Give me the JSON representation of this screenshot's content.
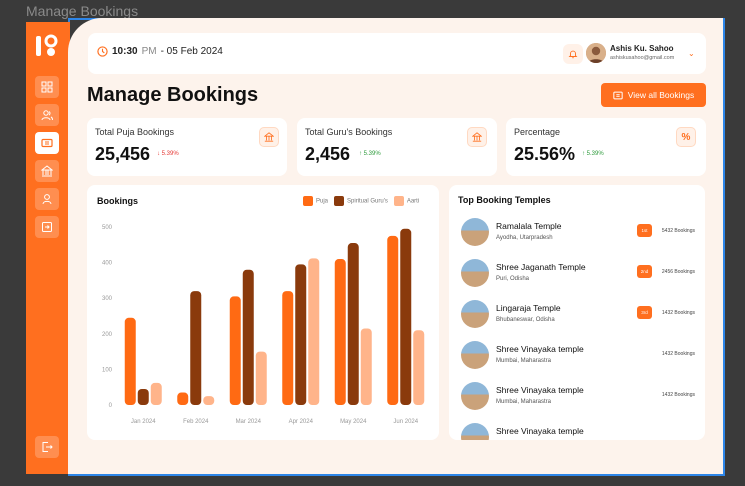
{
  "window": {
    "title": "Manage Bookings"
  },
  "header": {
    "time": "10:30",
    "ampm": "PM",
    "date": "- 05 Feb 2024",
    "user_name": "Ashis Ku. Sahoo",
    "user_email": "ashiskusahoo@gmail.com"
  },
  "page": {
    "title": "Manage Bookings",
    "view_all_label": "View all Bookings"
  },
  "stats": [
    {
      "label": "Total Puja Bookings",
      "value": "25,456",
      "change": "5.39%",
      "trend": "down",
      "color": "#e53935"
    },
    {
      "label": "Total  Guru's Bookings",
      "value": "2,456",
      "change": "5.39%",
      "trend": "up",
      "color": "#2e9b3c"
    },
    {
      "label": "Percentage",
      "value": "25.56%",
      "change": "5.39%",
      "trend": "up",
      "color": "#2e9b3c"
    }
  ],
  "chart_data": {
    "type": "bar",
    "title": "Bookings",
    "categories": [
      "Jan 2024",
      "Feb 2024",
      "Mar 2024",
      "Apr 2024",
      "May 2024",
      "Jun 2024"
    ],
    "series": [
      {
        "name": "Puja",
        "color": "#ff6a13",
        "values": [
          245,
          35,
          305,
          320,
          410,
          475
        ]
      },
      {
        "name": "Spiritual Guru's",
        "color": "#8a3a0c",
        "values": [
          45,
          320,
          380,
          395,
          455,
          495
        ]
      },
      {
        "name": "Aarti",
        "color": "#ffb48a",
        "values": [
          62,
          25,
          150,
          412,
          215,
          210
        ]
      }
    ],
    "yticks": [
      0,
      100,
      200,
      300,
      400,
      500
    ],
    "ylim": [
      0,
      500
    ],
    "legend": "top-right",
    "grid": false
  },
  "temples": {
    "title": "Top Booking Temples",
    "items": [
      {
        "name": "Ramalala Temple",
        "location": "Ayodha, Utarpradesh",
        "rank": "1st",
        "bookings": "5432 Bookings"
      },
      {
        "name": "Shree Jaganath Temple",
        "location": "Puri, Odisha",
        "rank": "2nd",
        "bookings": "2456 Bookings"
      },
      {
        "name": "Lingaraja Temple",
        "location": "Bhubaneswar, Odisha",
        "rank": "3rd",
        "bookings": "1432 Bookings"
      },
      {
        "name": "Shree Vinayaka temple",
        "location": "Mumbai, Maharastra",
        "rank": "",
        "bookings": "1432 Bookings"
      },
      {
        "name": "Shree Vinayaka temple",
        "location": "Mumbai, Maharastra",
        "rank": "",
        "bookings": "1432 Bookings"
      },
      {
        "name": "Shree Vinayaka temple",
        "location": "",
        "rank": "",
        "bookings": ""
      }
    ]
  },
  "icons": {
    "sidebar": [
      "dashboard-icon",
      "users-icon",
      "bookings-icon",
      "temple-icon",
      "profile-icon",
      "export-icon",
      "logout-icon"
    ]
  }
}
